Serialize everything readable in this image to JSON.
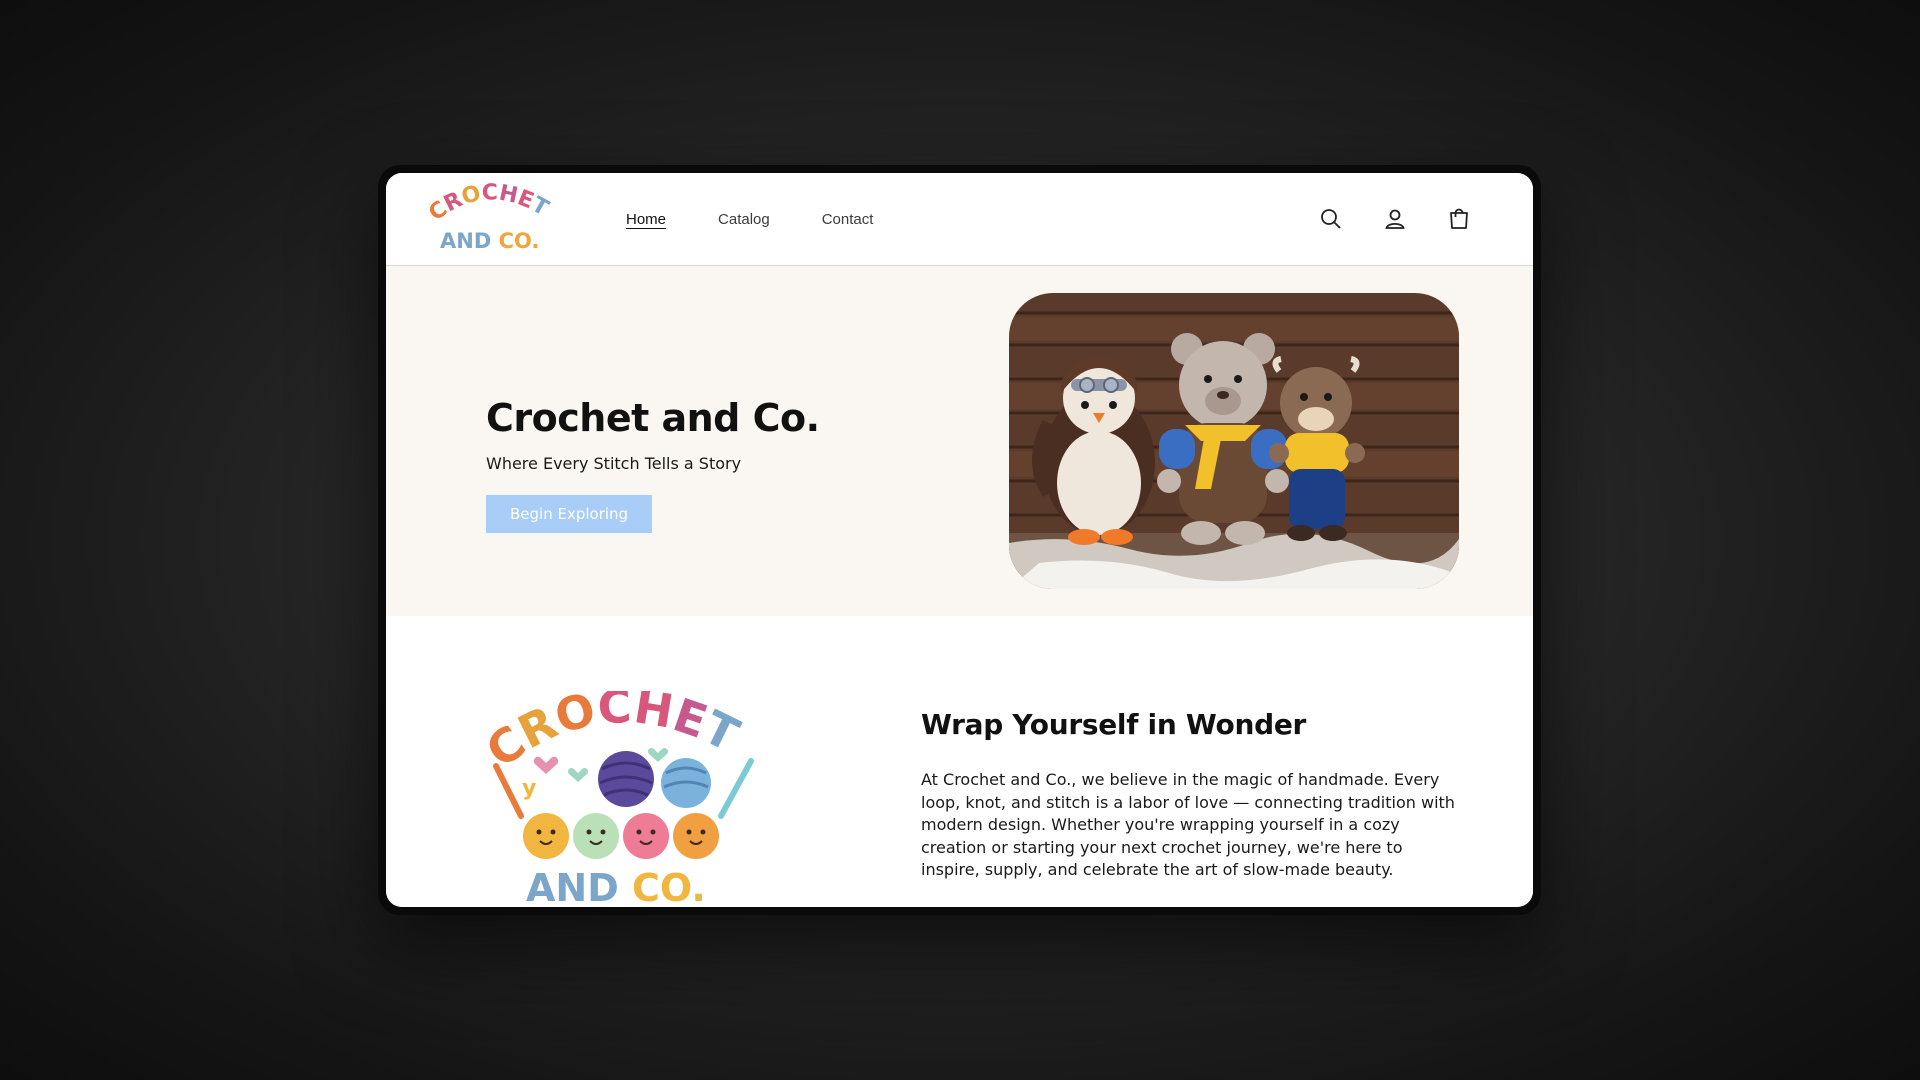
{
  "logo_small": {
    "line1": "CROCHET",
    "line2": "AND CO."
  },
  "nav": {
    "home": "Home",
    "catalog": "Catalog",
    "contact": "Contact"
  },
  "icons": {
    "search": "search-icon",
    "account": "account-icon",
    "cart": "cart-icon"
  },
  "hero": {
    "title": "Crochet and Co.",
    "subtitle": "Where Every Stitch Tells a Story",
    "button": "Begin Exploring",
    "image": "crochet-animals-photo"
  },
  "about": {
    "logo_line1": "CROCHET",
    "logo_line2": "AND CO.",
    "title": "Wrap Yourself in Wonder",
    "body": "At Crochet and Co., we believe in the magic of handmade. Every loop, knot, and stitch is a labor of love — connecting tradition with modern design. Whether you're wrapping yourself in a cozy creation or starting your next crochet journey, we're here to inspire, supply, and celebrate the art of slow-made beauty."
  },
  "colors": {
    "button": "#a8cdf6",
    "hero_bg": "#faf6f1",
    "logo_orange": "#e87b3c",
    "logo_pink": "#d9577a",
    "logo_blue": "#7ba6c9",
    "logo_yellow": "#f0b640"
  }
}
